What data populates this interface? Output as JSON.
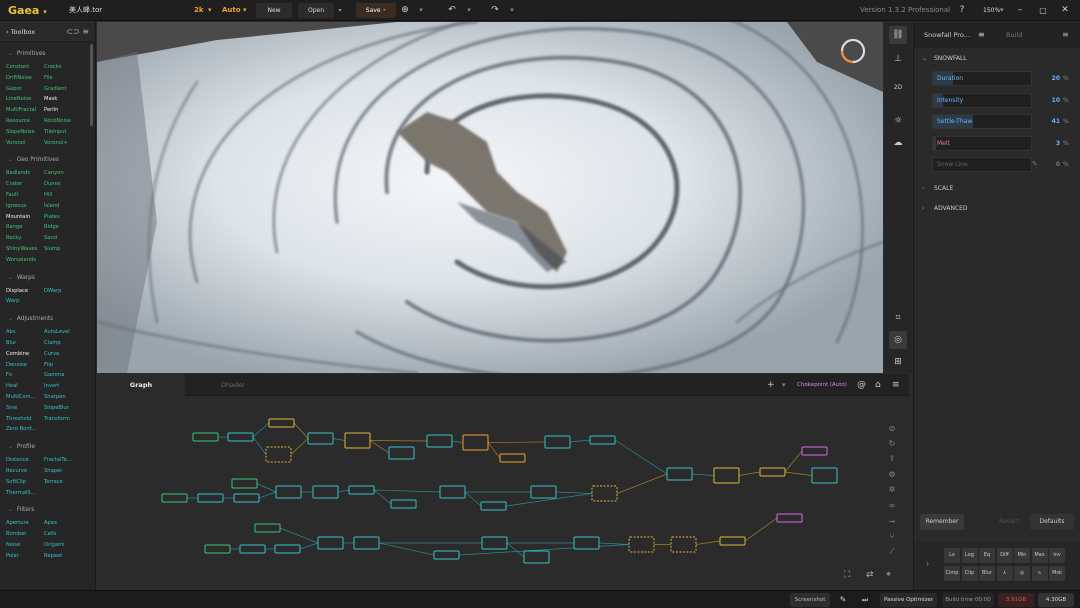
{
  "app": {
    "name": "Gaea",
    "file_name": "美人峰.tor",
    "resolution": "2k",
    "build_mode": "Auto",
    "version": "Version 1.3.2 Professional",
    "zoom": "150%"
  },
  "toolbar": {
    "new_label": "New",
    "open_label": "Open",
    "save_label": "Save"
  },
  "toolbox": {
    "title": "Toolbox",
    "sections": [
      {
        "title": "Primitives",
        "items": [
          {
            "label": "Constant",
            "color": "green"
          },
          {
            "label": "Cracks",
            "color": "green"
          },
          {
            "label": "DriftNoise",
            "color": "green"
          },
          {
            "label": "File",
            "color": "green"
          },
          {
            "label": "Gabor",
            "color": "green"
          },
          {
            "label": "Gradient",
            "color": "green"
          },
          {
            "label": "LineNoise",
            "color": "green"
          },
          {
            "label": "Mask",
            "color": "white"
          },
          {
            "label": "MultiFractal",
            "color": "green"
          },
          {
            "label": "Perlin",
            "color": "white"
          },
          {
            "label": "Resource",
            "color": "green"
          },
          {
            "label": "RockNoise",
            "color": "green"
          },
          {
            "label": "SlopeNoise",
            "color": "green"
          },
          {
            "label": "TileInput",
            "color": "green"
          },
          {
            "label": "Voronoi",
            "color": "green"
          },
          {
            "label": "Voronoi+",
            "color": "green"
          }
        ]
      },
      {
        "title": "Geo Primitives",
        "items": [
          {
            "label": "Badlands",
            "color": "green"
          },
          {
            "label": "Canyon",
            "color": "green"
          },
          {
            "label": "Crater",
            "color": "green"
          },
          {
            "label": "Dunes",
            "color": "green"
          },
          {
            "label": "Fault",
            "color": "green"
          },
          {
            "label": "Hill",
            "color": "green"
          },
          {
            "label": "Igneous",
            "color": "green"
          },
          {
            "label": "Island",
            "color": "green"
          },
          {
            "label": "Mountain",
            "color": "white"
          },
          {
            "label": "Plates",
            "color": "green"
          },
          {
            "label": "Range",
            "color": "green"
          },
          {
            "label": "Ridge",
            "color": "green"
          },
          {
            "label": "Rocky",
            "color": "green"
          },
          {
            "label": "Sand",
            "color": "green"
          },
          {
            "label": "ShinyWaves",
            "color": "green"
          },
          {
            "label": "Slump",
            "color": "green"
          },
          {
            "label": "Worselands",
            "color": "green"
          }
        ]
      },
      {
        "title": "Warps",
        "items": [
          {
            "label": "Displace",
            "color": "white"
          },
          {
            "label": "DWarp",
            "color": "teal"
          },
          {
            "label": "Warp",
            "color": "teal"
          }
        ]
      },
      {
        "title": "Adjustments",
        "items": [
          {
            "label": "Abs",
            "color": "teal"
          },
          {
            "label": "AutoLevel",
            "color": "teal"
          },
          {
            "label": "Blur",
            "color": "teal"
          },
          {
            "label": "Clamp",
            "color": "teal"
          },
          {
            "label": "Combine",
            "color": "white"
          },
          {
            "label": "Curve",
            "color": "teal"
          },
          {
            "label": "Denoise",
            "color": "teal"
          },
          {
            "label": "Flip",
            "color": "teal"
          },
          {
            "label": "Fx",
            "color": "teal"
          },
          {
            "label": "Gamma",
            "color": "teal"
          },
          {
            "label": "Heal",
            "color": "teal"
          },
          {
            "label": "Invert",
            "color": "teal"
          },
          {
            "label": "MultiCom...",
            "color": "teal"
          },
          {
            "label": "Sharpen",
            "color": "teal"
          },
          {
            "label": "Sine",
            "color": "teal"
          },
          {
            "label": "SlopeBlur",
            "color": "teal"
          },
          {
            "label": "Threshold",
            "color": "teal"
          },
          {
            "label": "Transform",
            "color": "teal"
          },
          {
            "label": "Zero Bord...",
            "color": "teal"
          }
        ]
      },
      {
        "title": "Profile",
        "items": [
          {
            "label": "Distance",
            "color": "teal"
          },
          {
            "label": "FractalTe...",
            "color": "teal"
          },
          {
            "label": "Recurve",
            "color": "teal"
          },
          {
            "label": "Shaper",
            "color": "teal"
          },
          {
            "label": "SoftClip",
            "color": "teal"
          },
          {
            "label": "Terrace",
            "color": "teal"
          },
          {
            "label": "ThermalS...",
            "color": "teal"
          }
        ]
      },
      {
        "title": "Filters",
        "items": [
          {
            "label": "Aperture",
            "color": "teal"
          },
          {
            "label": "Apex",
            "color": "teal"
          },
          {
            "label": "Bomber",
            "color": "teal"
          },
          {
            "label": "Cells",
            "color": "teal"
          },
          {
            "label": "Noise",
            "color": "teal"
          },
          {
            "label": "Origami",
            "color": "teal"
          },
          {
            "label": "Polar",
            "color": "teal"
          },
          {
            "label": "Repeat",
            "color": "teal"
          }
        ]
      }
    ]
  },
  "graph": {
    "tabs": [
      "Graph",
      "Dhader"
    ],
    "chokepoint_label": "Chokepoint (Auto)"
  },
  "props": {
    "tabs": [
      "Snowfall Pro...",
      "Build"
    ],
    "section_title": "SNOWFALL",
    "fields": [
      {
        "label": "Duration",
        "value": 20,
        "unit": "%",
        "active": true
      },
      {
        "label": "Intensity",
        "value": 10,
        "unit": "%",
        "active": true
      },
      {
        "label": "Settle-Thaw",
        "value": 41,
        "unit": "%",
        "active": true
      },
      {
        "label": "Melt",
        "value": 3,
        "unit": "%",
        "active": true
      },
      {
        "label": "Snow Line",
        "value": 0,
        "unit": "%",
        "active": false
      }
    ],
    "collapsed_sections": [
      "SCALE",
      "ADVANCED"
    ],
    "remember_label": "Remember",
    "revert_label": "Revert",
    "defaults_label": "Defaults"
  },
  "ops": {
    "row1": [
      "Lx",
      "Log",
      "Eq",
      "Diff",
      "Min",
      "Max",
      "Inv"
    ],
    "row2": [
      "Clmp",
      "Clip",
      "Blur",
      "⅄",
      "◎",
      "∿",
      "Msk"
    ]
  },
  "status": {
    "screenshot_label": "Screenshot",
    "optimizer_label": "Passive Optimizer",
    "build_time": "Build time 00:00",
    "memory_used": "3.91GB",
    "memory_total": "4.30GB"
  },
  "colors": {
    "accent": "#e8c43a",
    "orange": "#f0a030",
    "node_green": "#3ec67a",
    "node_teal": "#34c2c8",
    "node_yellow": "#e2b53a",
    "node_pink": "#d86ae8",
    "field_blue": "#6fb3ff"
  }
}
